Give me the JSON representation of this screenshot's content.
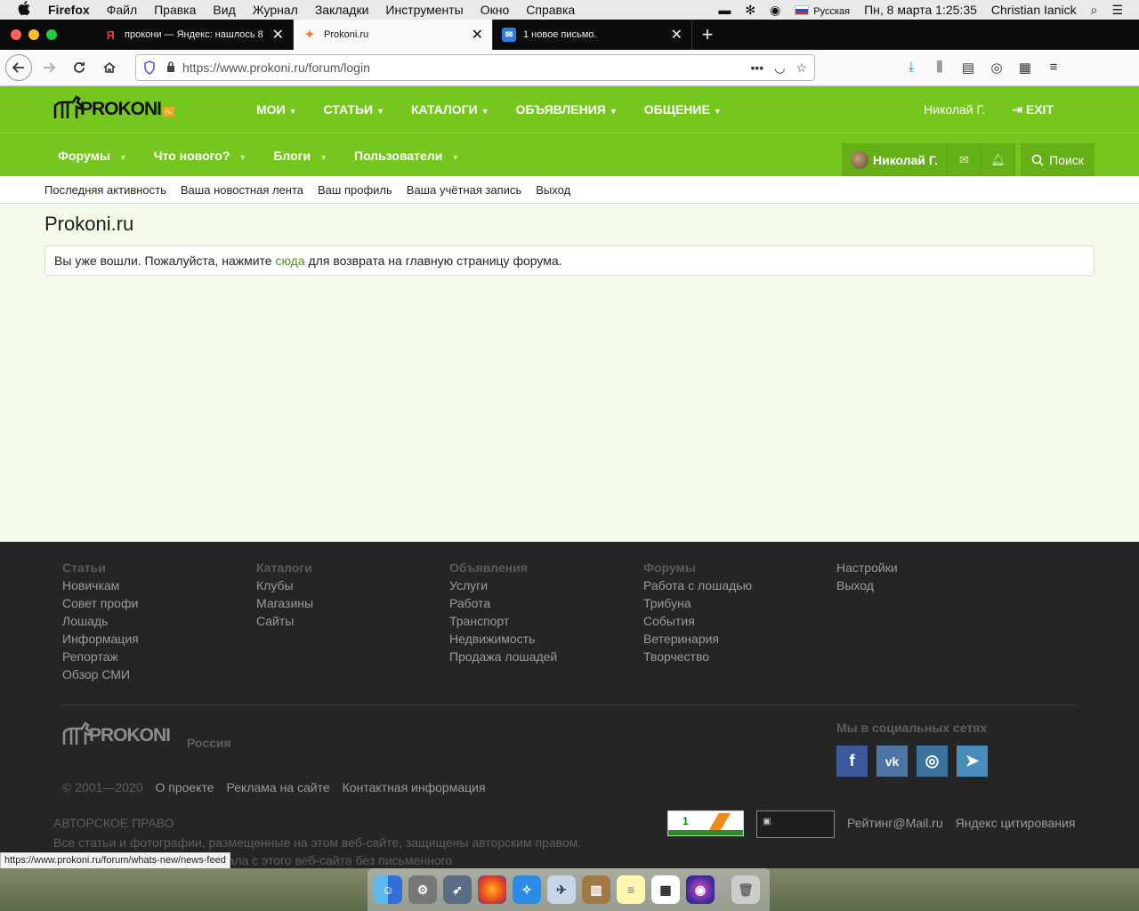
{
  "menubar": {
    "apple": "",
    "items": [
      "Firefox",
      "Файл",
      "Правка",
      "Вид",
      "Журнал",
      "Закладки",
      "Инструменты",
      "Окно",
      "Справка"
    ],
    "input_source": "Русская",
    "datetime": "Пн, 8 марта  1:25:35",
    "user": "Christian Ianick"
  },
  "tabs": [
    {
      "favicon": "Я",
      "title": "прокони — Яндекс: нашлось 8",
      "close": "✕"
    },
    {
      "favicon": "✦",
      "title": "Prokoni.ru",
      "close": "✕"
    },
    {
      "favicon": "✉",
      "title": "1 новое письмо.",
      "close": "✕"
    }
  ],
  "new_tab": "+",
  "nav": {
    "url": "https://www.prokoni.ru/forum/login"
  },
  "site": {
    "logo_text": "PROKONI",
    "logo_ru": "ru",
    "top_menu": [
      "МОИ",
      "СТАТЬИ",
      "КАТАЛОГИ",
      "ОБЪЯВЛЕНИЯ",
      "ОБЩЕНИЕ"
    ],
    "user_name": "Николай Г.",
    "exit": "EXIT"
  },
  "forum_nav": {
    "items": [
      "Форумы",
      "Что нового?",
      "Блоги",
      "Пользователи"
    ],
    "user": "Николай Г.",
    "search": "Поиск"
  },
  "sub_nav": [
    "Последняя активность",
    "Ваша новостная лента",
    "Ваш профиль",
    "Ваша учётная запись",
    "Выход"
  ],
  "content": {
    "title": "Prokoni.ru",
    "notice_before": "Вы уже вошли. Пожалуйста, нажмите ",
    "notice_link": "сюда",
    "notice_after": " для возврата на главную страницу форума."
  },
  "footer": {
    "columns": [
      {
        "heading": "Статьи",
        "links": [
          "Новичкам",
          "Совет профи",
          "Лошадь",
          "Информация",
          "Репортаж",
          "Обзор СМИ"
        ]
      },
      {
        "heading": "Каталоги",
        "links": [
          "Клубы",
          "Магазины",
          "Сайты"
        ]
      },
      {
        "heading": "Объявления",
        "links": [
          "Услуги",
          "Работа",
          "Транспорт",
          "Недвижимость",
          "Продажа лошадей"
        ]
      },
      {
        "heading": "Форумы",
        "links": [
          "Работа с лошадью",
          "Трибуна",
          "События",
          "Ветеринария",
          "Творчество"
        ]
      },
      {
        "heading": "",
        "links": [
          "Настройки",
          "Выход"
        ]
      }
    ],
    "logo_text": "PROKONI",
    "region": "Россия",
    "social_heading": "Мы в социальных сетях",
    "social": [
      {
        "icon": "facebook-icon",
        "glyph": "f",
        "color": "#3b5998"
      },
      {
        "icon": "vk-icon",
        "glyph": "vk",
        "color": "#4c75a3"
      },
      {
        "icon": "instagram-icon",
        "glyph": "◎",
        "color": "#3f729b"
      },
      {
        "icon": "telegram-icon",
        "glyph": "➤",
        "color": "#4a8dbd"
      }
    ],
    "copyright": "© 2001—2020",
    "links": [
      "О проекте",
      "Реклама на сайте",
      "Контактная информация"
    ],
    "rights_heading": "АВТОРСКОЕ ПРАВО",
    "rights_line1": "Все статьи и фотографии, размещенные на этом веб-сайте, защищены авторским правом.",
    "rights_line2": "Любое использование материала с этого веб-сайта без письменного",
    "counter_num": "1",
    "ratings": [
      "Рейтинг@Mail.ru",
      "Яндекс цитирования"
    ]
  },
  "status_url": "https://www.prokoni.ru/forum/whats-new/news-feed",
  "colors": {
    "brand_green": "#75c61e",
    "footer_bg": "#252525",
    "content_bg": "#f4fbe9"
  }
}
